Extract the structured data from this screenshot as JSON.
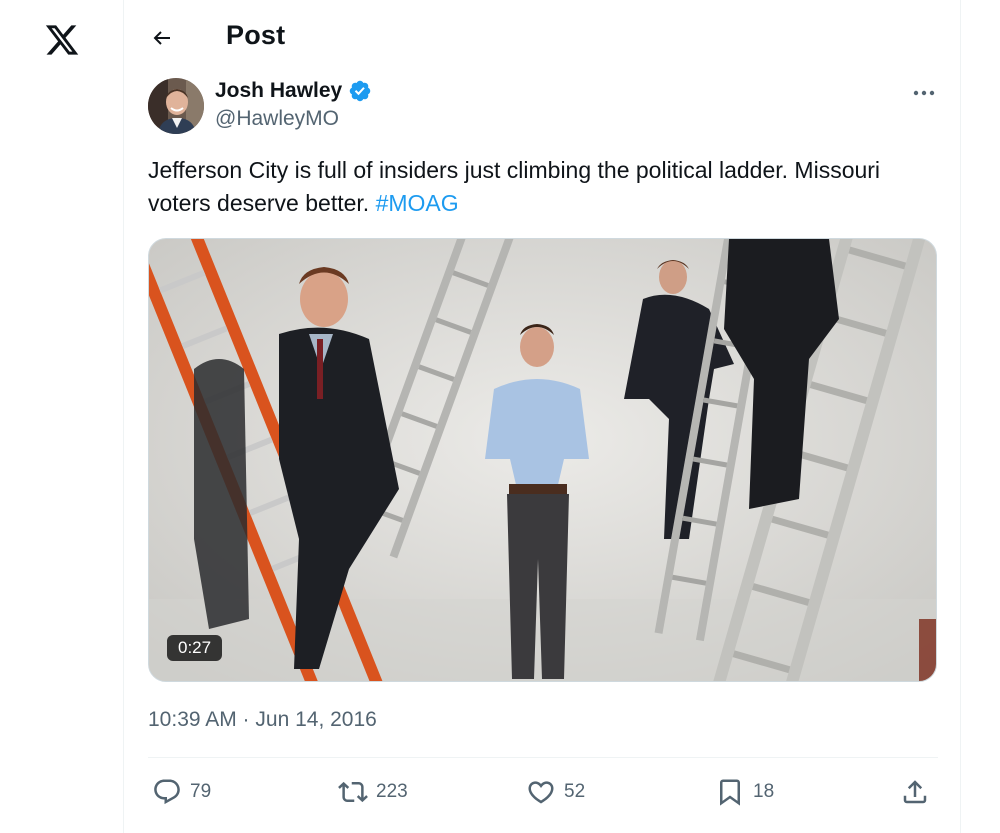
{
  "header": {
    "title": "Post"
  },
  "author": {
    "name": "Josh Hawley",
    "handle": "@HawleyMO",
    "verified": true
  },
  "post": {
    "text": "Jefferson City is full of insiders just climbing the political ladder. Missouri voters deserve better. ",
    "hashtag": "#MOAG",
    "video_duration": "0:27",
    "timestamp": "10:39 AM · Jun 14, 2016"
  },
  "actions": {
    "replies": "79",
    "reposts": "223",
    "likes": "52",
    "bookmarks": "18"
  },
  "icons": {
    "logo": "x-logo",
    "back": "arrow-left-icon",
    "verified": "verified-badge-icon",
    "more": "more-dots-icon",
    "reply": "reply-icon",
    "repost": "repost-icon",
    "like": "heart-icon",
    "bookmark": "bookmark-icon",
    "share": "share-icon"
  },
  "colors": {
    "accent": "#1d9bf0",
    "text": "#0f1419",
    "muted": "#536471"
  }
}
